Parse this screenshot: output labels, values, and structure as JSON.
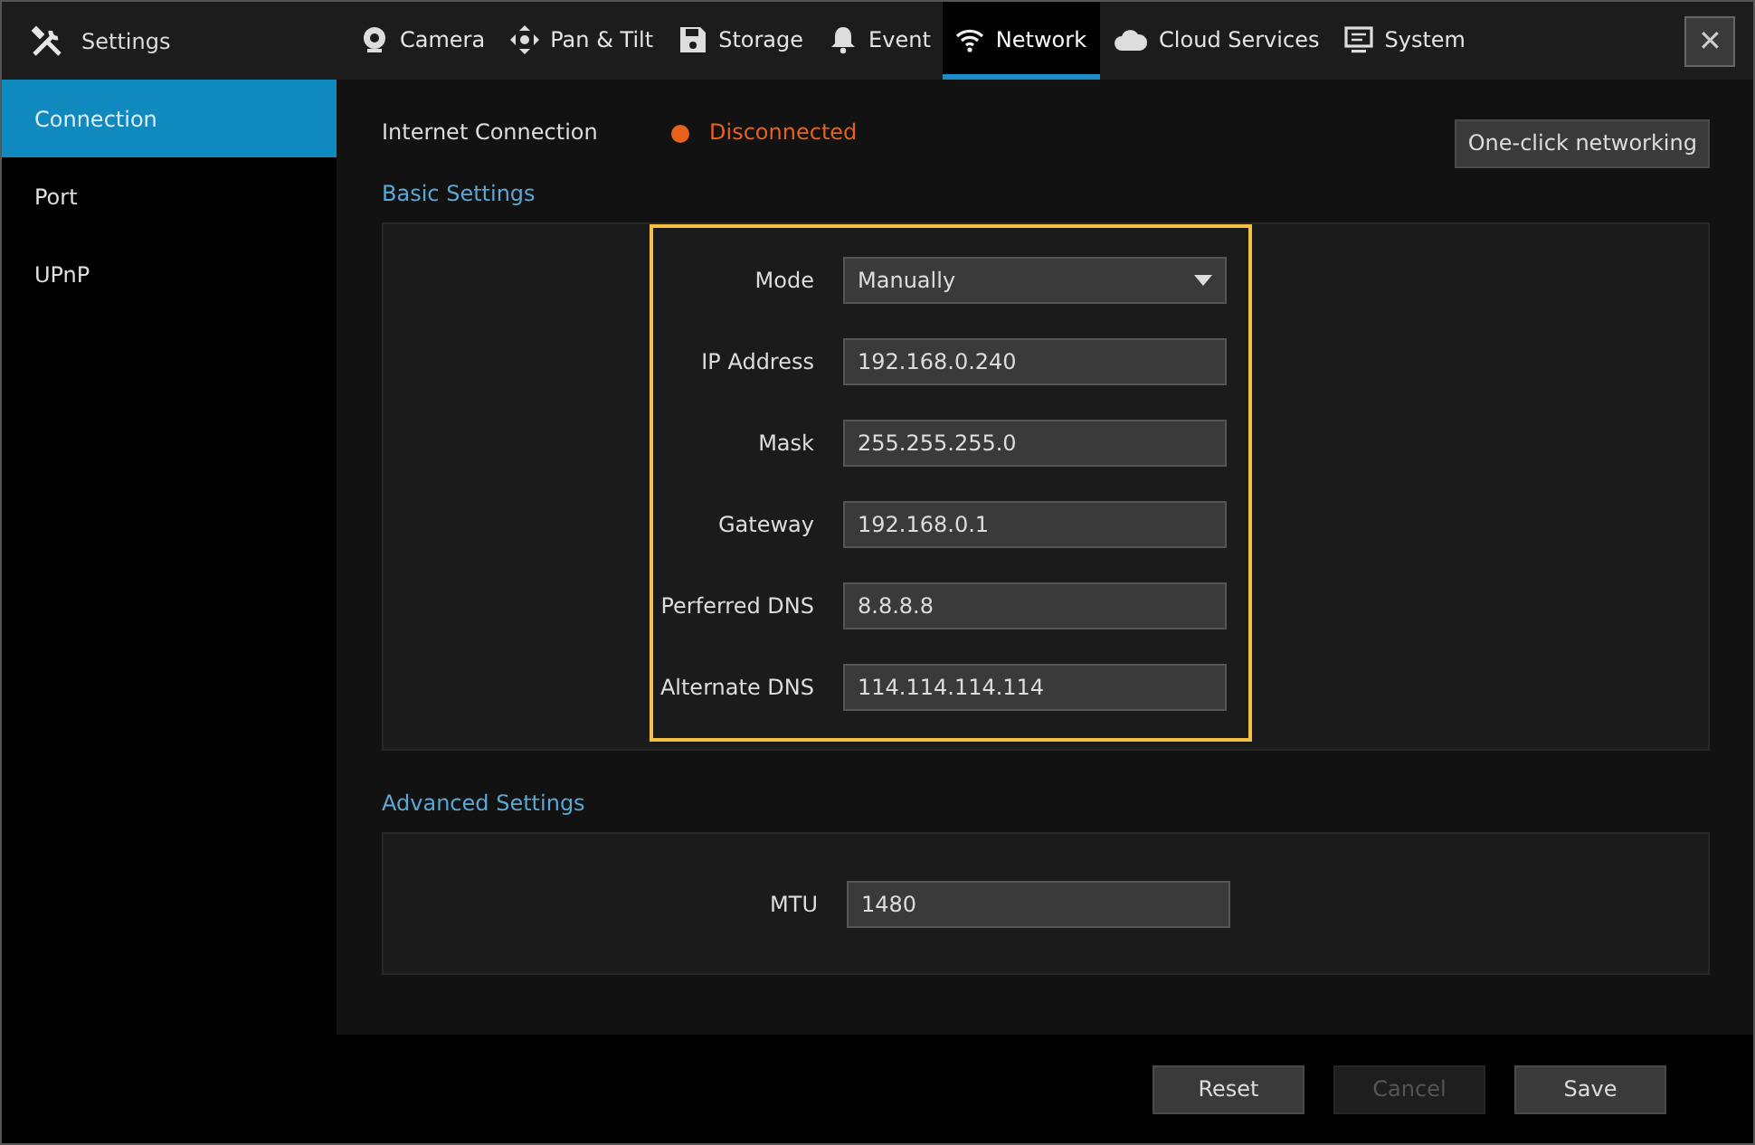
{
  "header": {
    "title": "Settings",
    "close": "✕"
  },
  "tabs": [
    {
      "label": "Camera",
      "selected": false
    },
    {
      "label": "Pan & Tilt",
      "selected": false
    },
    {
      "label": "Storage",
      "selected": false
    },
    {
      "label": "Event",
      "selected": false
    },
    {
      "label": "Network",
      "selected": true
    },
    {
      "label": "Cloud Services",
      "selected": false
    },
    {
      "label": "System",
      "selected": false
    }
  ],
  "sidebar": {
    "items": [
      {
        "label": "Connection",
        "selected": true
      },
      {
        "label": "Port",
        "selected": false
      },
      {
        "label": "UPnP",
        "selected": false
      }
    ]
  },
  "internet_connection": {
    "label": "Internet Connection",
    "status": "Disconnected",
    "color": "#e8621e"
  },
  "one_click_button": "One-click networking",
  "basic_settings": {
    "title": "Basic Settings",
    "fields": [
      {
        "label": "Mode",
        "value": "Manually",
        "kind": "select"
      },
      {
        "label": "IP Address",
        "value": "192.168.0.240",
        "kind": "text"
      },
      {
        "label": "Mask",
        "value": "255.255.255.0",
        "kind": "text"
      },
      {
        "label": "Gateway",
        "value": "192.168.0.1",
        "kind": "text"
      },
      {
        "label": "Perferred DNS",
        "value": "8.8.8.8",
        "kind": "text"
      },
      {
        "label": "Alternate DNS",
        "value": "114.114.114.114",
        "kind": "text"
      }
    ]
  },
  "advanced_settings": {
    "title": "Advanced Settings",
    "fields": [
      {
        "label": "MTU",
        "value": "1480",
        "kind": "text"
      }
    ]
  },
  "buttons": [
    {
      "label": "Reset",
      "disabled": false
    },
    {
      "label": "Cancel",
      "disabled": true
    },
    {
      "label": "Save",
      "disabled": false
    }
  ]
}
